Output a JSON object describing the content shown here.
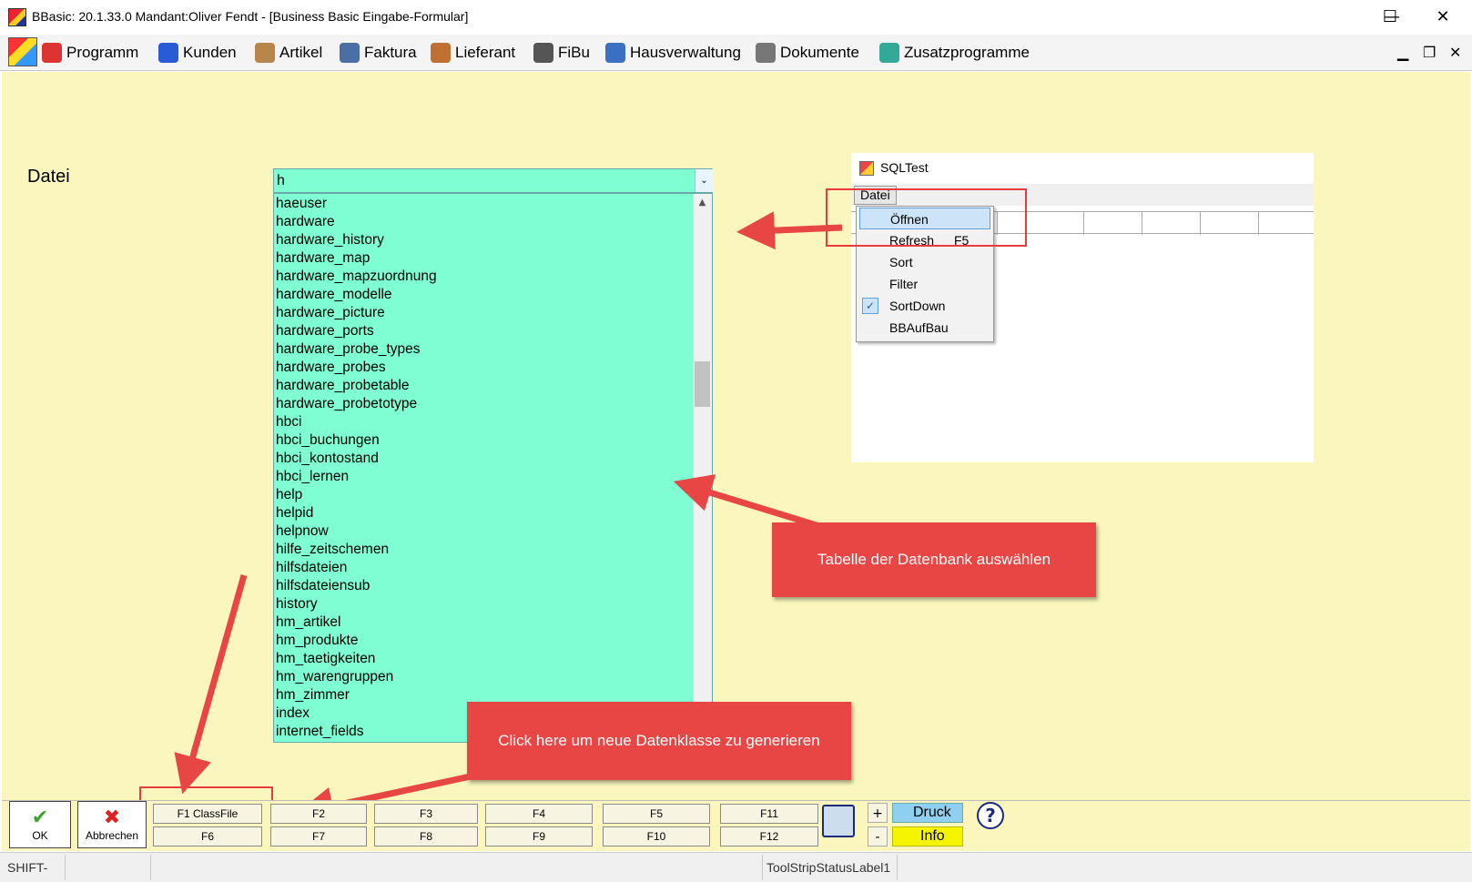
{
  "window": {
    "title": "BBasic: 20.1.33.0 Mandant:Oliver Fendt  - [Business Basic Eingabe-Formular]",
    "minimize": "—",
    "maximize": "☐",
    "close": "✕"
  },
  "menu": {
    "items": [
      {
        "label": "Programm",
        "icon": "programm-icon",
        "color": "#d33"
      },
      {
        "label": "Kunden",
        "icon": "users-icon",
        "color": "#2a5bd7"
      },
      {
        "label": "Artikel",
        "icon": "box-icon",
        "color": "#b8864a"
      },
      {
        "label": "Faktura",
        "icon": "building-icon",
        "color": "#4a6fa5"
      },
      {
        "label": "Lieferant",
        "icon": "supplier-icon",
        "color": "#c07030"
      },
      {
        "label": "FiBu",
        "icon": "calculator-icon",
        "color": "#555"
      },
      {
        "label": "Hausverwaltung",
        "icon": "house-icon",
        "color": "#3a6fc2"
      },
      {
        "label": "Dokumente",
        "icon": "document-icon",
        "color": "#777"
      },
      {
        "label": "Zusatzprogramme",
        "icon": "puzzle-icon",
        "color": "#3a9"
      }
    ],
    "mdi_minimize": "▁",
    "mdi_restore": "❐",
    "mdi_close": "✕"
  },
  "form": {
    "datei_label": "Datei",
    "combo_value": "h",
    "combo_arrow": "⌄",
    "list": [
      "haeuser",
      "hardware",
      "hardware_history",
      "hardware_map",
      "hardware_mapzuordnung",
      "hardware_modelle",
      "hardware_picture",
      "hardware_ports",
      "hardware_probe_types",
      "hardware_probes",
      "hardware_probetable",
      "hardware_probetotype",
      "hbci",
      "hbci_buchungen",
      "hbci_kontostand",
      "hbci_lernen",
      "help",
      "helpid",
      "helpnow",
      "hilfe_zeitschemen",
      "hilfsdateien",
      "hilfsdateiensub",
      "history",
      "hm_artikel",
      "hm_produkte",
      "hm_taetigkeiten",
      "hm_warengruppen",
      "hm_zimmer",
      "index",
      "internet_fields"
    ],
    "scroll_up": "▲"
  },
  "sqltest": {
    "title": "SQLTest",
    "menu_datei": "Datei",
    "context_menu": [
      {
        "label": "Öffnen",
        "shortcut": "",
        "highlighted": true,
        "checked": false
      },
      {
        "label": "Refresh",
        "shortcut": "F5",
        "highlighted": false,
        "checked": false
      },
      {
        "label": "Sort",
        "shortcut": "",
        "highlighted": false,
        "checked": false
      },
      {
        "label": "Filter",
        "shortcut": "",
        "highlighted": false,
        "checked": false
      },
      {
        "label": "SortDown",
        "shortcut": "",
        "highlighted": false,
        "checked": true
      },
      {
        "label": "BBAufBau",
        "shortcut": "",
        "highlighted": false,
        "checked": false
      }
    ],
    "check_mark": "✓"
  },
  "callouts": {
    "table": "Tabelle der Datenbank auswählen",
    "classfile": "Click here um neue Datenklasse zu generieren",
    "color": "#e84545"
  },
  "toolbar": {
    "ok": {
      "label": "OK",
      "icon": "✔"
    },
    "abbrechen": {
      "label": "Abbrechen",
      "icon": "✖"
    },
    "fkeys_top": [
      "F1 ClassFile",
      "F2",
      "F3",
      "F4",
      "F5",
      "F11"
    ],
    "fkeys_bottom": [
      "F6",
      "F7",
      "F8",
      "F9",
      "F10",
      "F12"
    ],
    "plus": "+",
    "minus": "-",
    "druck": "Druck",
    "info": "Info",
    "help": "?"
  },
  "status": {
    "cell1": "SHIFT-Tas",
    "cell2": "",
    "label": "ToolStripStatusLabel1"
  }
}
